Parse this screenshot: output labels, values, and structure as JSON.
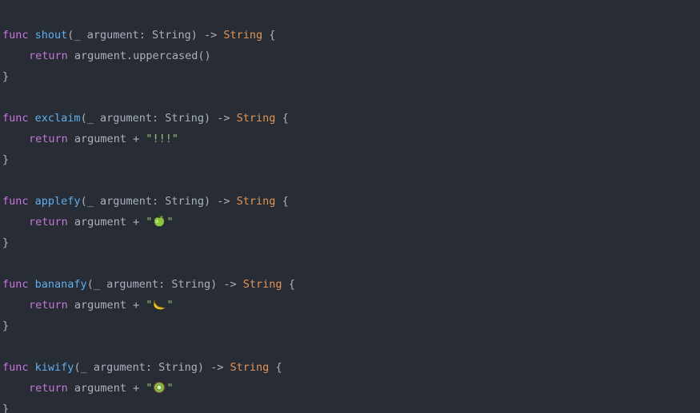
{
  "colors": {
    "background": "#282c34",
    "keyword": "#c678dd",
    "function_name": "#61afef",
    "type": "#e5c07b",
    "string": "#98c379",
    "plain": "#abb2bf"
  },
  "tokens": {
    "func": "func",
    "return": "return",
    "open_paren": "(",
    "param": "_ argument: String",
    "close_arrow": ") -> ",
    "return_type": "String",
    "open_brace": " {",
    "close_brace": "}",
    "body_arg": "argument",
    "plus": " + ",
    "quote": "\""
  },
  "functions": [
    {
      "name": "shout",
      "body": "argument.uppercased()"
    },
    {
      "name": "exclaim",
      "string_literal": "\"!!!\""
    },
    {
      "name": "applefy",
      "emoji": "green-apple-icon"
    },
    {
      "name": "bananafy",
      "emoji": "banana-icon"
    },
    {
      "name": "kiwify",
      "emoji": "kiwi-icon"
    }
  ]
}
